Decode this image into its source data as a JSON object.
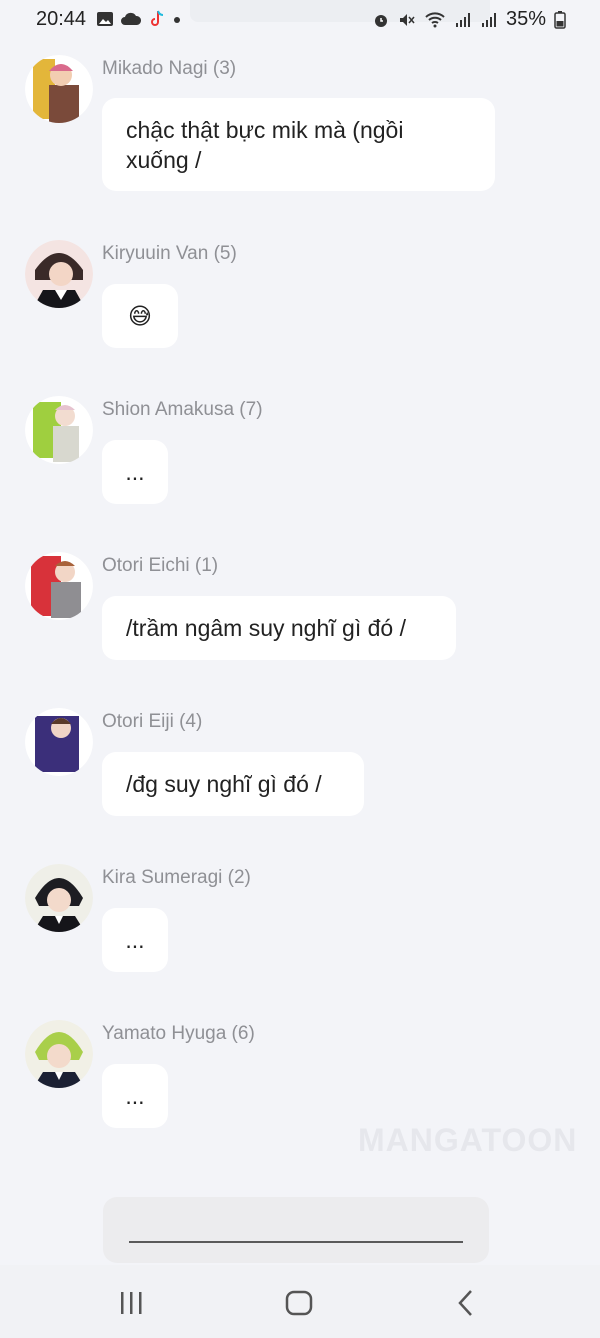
{
  "status_bar": {
    "time": "20:44",
    "left_icons": [
      "image-icon",
      "cloud-icon",
      "tiktok-icon",
      "dot-icon"
    ],
    "right_icons": [
      "alarm-icon",
      "mute-icon",
      "wifi-icon",
      "signal-icon",
      "signal-icon"
    ],
    "battery": "35%"
  },
  "messages": [
    {
      "sender": "Mikado Nagi (3)",
      "text": "chậc thật bực mik mà (ngồi xuống /",
      "avatar_color": "#d9b13b"
    },
    {
      "sender": "Kiryuuin Van (5)",
      "text": "😅",
      "avatar_color": "#3a2a28"
    },
    {
      "sender": "Shion Amakusa (7)",
      "text": "...",
      "avatar_color": "#9fcf3f"
    },
    {
      "sender": "Otori Eichi (1)",
      "text": "/trầm ngâm suy nghĩ gì đó /",
      "avatar_color": "#d8323a"
    },
    {
      "sender": "Otori Eiji (4)",
      "text": "/đg suy nghĩ gì đó /",
      "avatar_color": "#3b2f7a"
    },
    {
      "sender": "Kira Sumeragi (2)",
      "text": "...",
      "avatar_color": "#1d1d22"
    },
    {
      "sender": "Yamato Hyuga (6)",
      "text": "...",
      "avatar_color": "#a9cf4a"
    }
  ],
  "watermark": "MANGATOON",
  "nav": {
    "recent": "recent-apps-icon",
    "home": "home-icon",
    "back": "back-icon"
  }
}
